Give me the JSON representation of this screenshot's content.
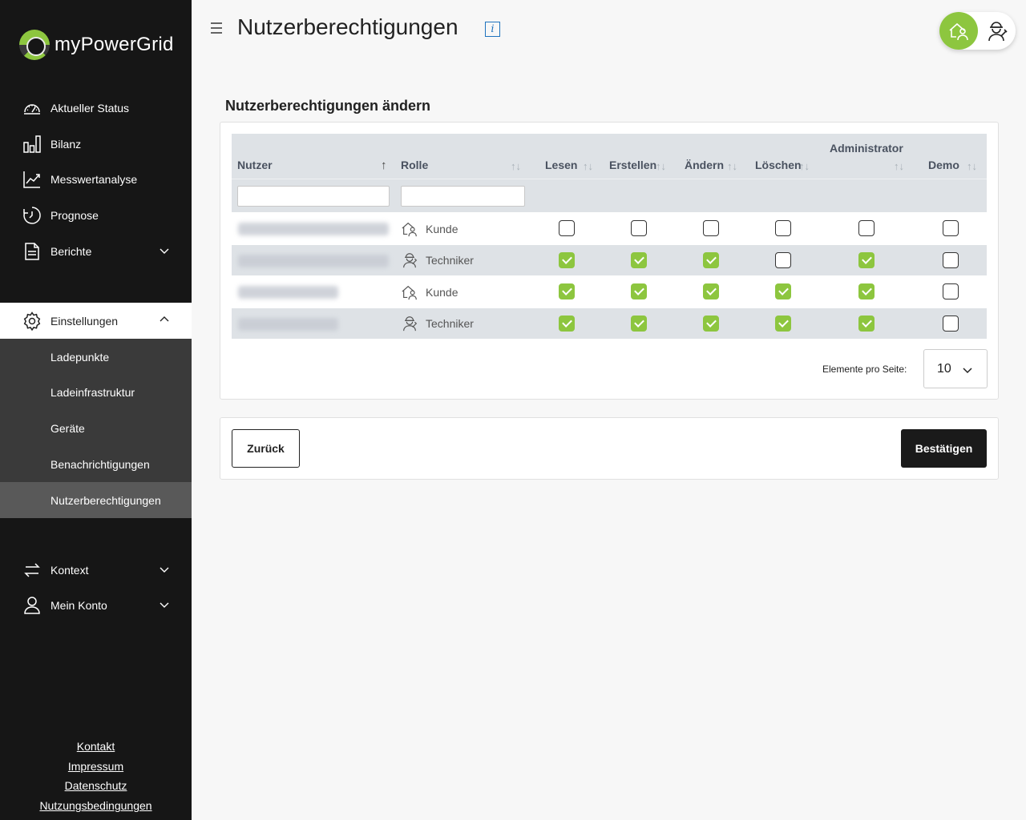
{
  "brand": {
    "name": "myPowerGrid"
  },
  "page": {
    "title": "Nutzerberechtigungen",
    "section_title": "Nutzerberechtigungen ändern"
  },
  "sidebar": {
    "items": [
      {
        "label": "Aktueller Status",
        "icon": "gauge-icon"
      },
      {
        "label": "Bilanz",
        "icon": "bar-chart-icon"
      },
      {
        "label": "Messwertanalyse",
        "icon": "line-chart-icon"
      },
      {
        "label": "Prognose",
        "icon": "clock-icon"
      },
      {
        "label": "Berichte",
        "icon": "document-icon"
      },
      {
        "label": "Einstellungen",
        "icon": "gear-icon"
      },
      {
        "label": "Kontext",
        "icon": "swap-arrows-icon"
      },
      {
        "label": "Mein Konto",
        "icon": "user-icon"
      }
    ],
    "sub_items": [
      {
        "label": "Ladepunkte"
      },
      {
        "label": "Ladeinfrastruktur"
      },
      {
        "label": "Geräte"
      },
      {
        "label": "Benachrichtigungen"
      },
      {
        "label": "Nutzerberechtigungen"
      }
    ],
    "active_item": "Einstellungen",
    "active_sub_item": "Nutzerberechtigungen",
    "footer_links": [
      "Kontakt",
      "Impressum",
      "Datenschutz",
      "Nutzungsbedingungen"
    ]
  },
  "table": {
    "columns": [
      "Nutzer",
      "Rolle",
      "Lesen",
      "Erstellen",
      "Ändern",
      "Löschen",
      "Administrator",
      "Demo"
    ],
    "filters": {
      "nutzer": "",
      "rolle": ""
    },
    "rows": [
      {
        "user": "",
        "role": "Kunde",
        "role_icon": "customer-house-icon",
        "perms": [
          false,
          false,
          false,
          false,
          false,
          false
        ]
      },
      {
        "user": "",
        "role": "Techniker",
        "role_icon": "technician-icon",
        "perms": [
          true,
          true,
          true,
          false,
          true,
          false
        ]
      },
      {
        "user": "",
        "role": "Kunde",
        "role_icon": "customer-house-icon",
        "perms": [
          true,
          true,
          true,
          true,
          true,
          false
        ]
      },
      {
        "user": "",
        "role": "Techniker",
        "role_icon": "technician-icon",
        "perms": [
          true,
          true,
          true,
          true,
          true,
          false
        ]
      }
    ]
  },
  "pagination": {
    "label": "Elemente pro Seite:",
    "value": "10"
  },
  "buttons": {
    "back": "Zurück",
    "confirm": "Bestätigen"
  },
  "colors": {
    "accent": "#8dc63f",
    "sidebar": "#161616",
    "header_row": "#dee2e6",
    "link": "#1e73be"
  }
}
